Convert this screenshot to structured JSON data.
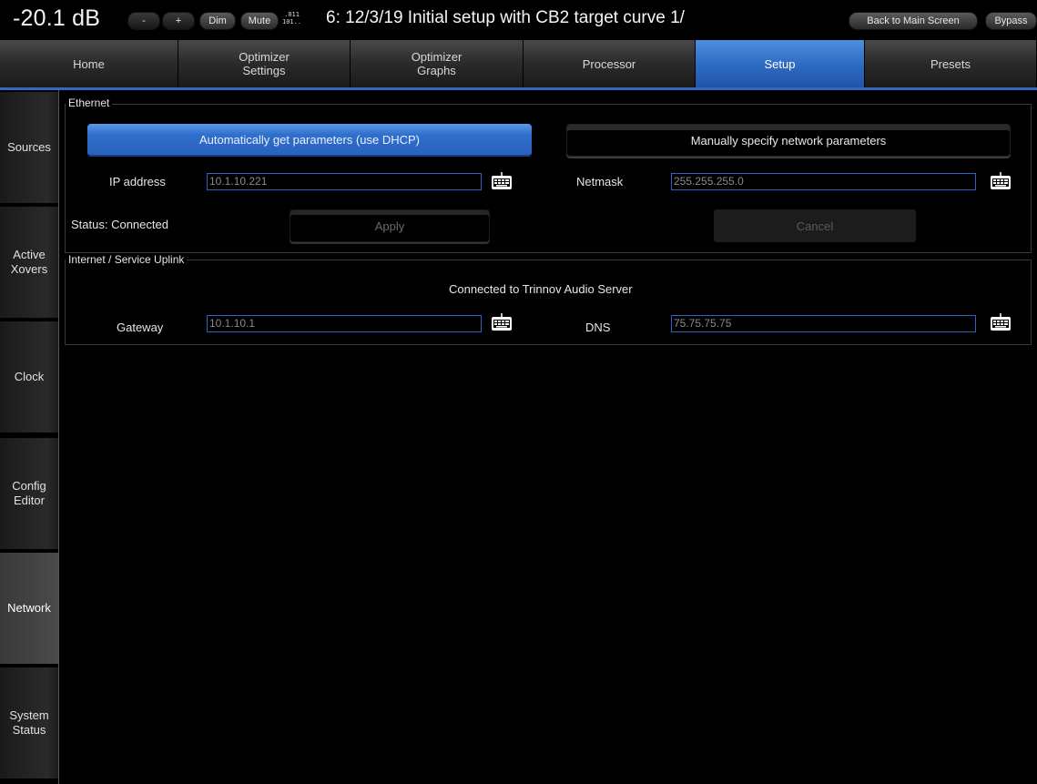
{
  "header": {
    "volume": "-20.1 dB",
    "vol_down_label": "-",
    "vol_up_label": "+",
    "dim_label": "Dim",
    "mute_label": "Mute",
    "binary_line1": ".011",
    "binary_line2": "101..",
    "preset_title": "6: 12/3/19 Initial setup with CB2 target curve 1/",
    "back_label": "Back to Main Screen",
    "bypass_label": "Bypass"
  },
  "tabs": [
    {
      "label": "Home"
    },
    {
      "label": "Optimizer\nSettings"
    },
    {
      "label": "Optimizer\nGraphs"
    },
    {
      "label": "Processor"
    },
    {
      "label": "Setup",
      "active": true
    },
    {
      "label": "Presets"
    }
  ],
  "sidebar": [
    {
      "label": "Sources"
    },
    {
      "label": "Active\nXovers"
    },
    {
      "label": "Clock"
    },
    {
      "label": "Config\nEditor"
    },
    {
      "label": "Network",
      "active": true
    },
    {
      "label": "System\nStatus"
    }
  ],
  "ethernet": {
    "legend": "Ethernet",
    "dhcp_button": "Automatically get parameters (use DHCP)",
    "manual_button": "Manually specify network parameters",
    "ip_label": "IP address",
    "ip_value": "10.1.10.221",
    "netmask_label": "Netmask",
    "netmask_value": "255.255.255.0",
    "status": "Status: Connected",
    "apply_label": "Apply",
    "cancel_label": "Cancel"
  },
  "uplink": {
    "legend": "Internet / Service Uplink",
    "status_text": "Connected to Trinnov Audio Server",
    "gateway_label": "Gateway",
    "gateway_value": "10.1.10.1",
    "dns_label": "DNS",
    "dns_value": "75.75.75.75"
  },
  "colors": {
    "accent": "#2f6cc4",
    "field_border": "#2a64c0"
  }
}
